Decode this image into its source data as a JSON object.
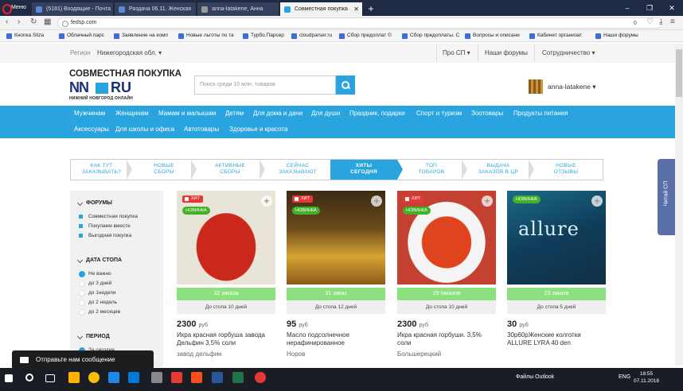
{
  "browser": {
    "menu_label": "Меню",
    "tabs": [
      {
        "label": "(5181) Входящие - Почта"
      },
      {
        "label": "Раздача 06.11. Женская"
      },
      {
        "label": "anna-latakene, Анна"
      },
      {
        "label": "Совместная покупка"
      }
    ],
    "url": "fedsp.com",
    "badge_count": "0",
    "bookmarks": [
      "Кнопка Sliza",
      "Облачный парс",
      "Заявление на комп",
      "Новые льготы по та",
      "Турбо.Парсер",
      "cloudparser.ru",
      "Сбор предоплат ©",
      "Сбор предоплаты. С",
      "Вопросы и описани",
      "Кабинет организат",
      "Наши форумы"
    ]
  },
  "topnav": {
    "region_label": "Регион",
    "region_value": "Нижегородская обл.",
    "about": "Про СП",
    "forums": "Наши форумы",
    "cooperation": "Сотрудничество"
  },
  "header": {
    "title": "СОВМЕСТНАЯ ПОКУПКА",
    "logo_left": "NN",
    "logo_right": "RU",
    "logo_sub": "НИЖНИЙ НОВГОРОД ОНЛАЙН",
    "search_placeholder": "Поиск среди 10 млн. товаров",
    "username": "anna-latakene"
  },
  "categories": {
    "row1": [
      "Мужчинам",
      "Женщинам",
      "Мамам и малышам",
      "Детям",
      "Для дома и дачи",
      "Для души",
      "Праздник, подарки",
      "Спорт и туризм",
      "Зоотовары",
      "Продукты питания"
    ],
    "row2": [
      "Аксессуары",
      "Для школы и офиса",
      "Автотовары",
      "Здоровье и красота"
    ]
  },
  "steps": [
    {
      "line1": "КАК ТУТ",
      "line2": "ЗАКАЗЫВАТЬ?"
    },
    {
      "line1": "НОВЫЕ",
      "line2": "СБОРЫ"
    },
    {
      "line1": "АКТИВНЫЕ",
      "line2": "СБОРЫ"
    },
    {
      "line1": "СЕЙЧАС",
      "line2": "ЗАКАЗЫВАЮТ"
    },
    {
      "line1": "ХИТЫ",
      "line2": "СЕГОДНЯ"
    },
    {
      "line1": "ТОП",
      "line2": "ТОВАРОВ"
    },
    {
      "line1": "ВЫДАЧА",
      "line2": "ЗАКАЗОВ В ЦР"
    },
    {
      "line1": "НОВЫЕ",
      "line2": "ОТЗЫВЫ"
    }
  ],
  "sidebar": {
    "forums_title": "ФОРУМЫ",
    "forums": [
      "Совместная покупка",
      "Покупаем вместе",
      "Выгодная покупка"
    ],
    "stop_title": "ДАТА СТОПА",
    "stop_options": [
      "Не важно",
      "до 3 дней",
      "до 1недели",
      "до 2 недель",
      "до 2 месяцев"
    ],
    "period_title": "ПЕРИОД",
    "period_first": "За сегодня"
  },
  "badges": {
    "hit": "ХИТ",
    "new": "НОВИНКА"
  },
  "products": [
    {
      "orders": "32 заказа",
      "stop": "До стопа 10 дней",
      "price": "2300",
      "currency": "руб",
      "title": "Икра красная горбуша завода Дельфин 3,5% соли",
      "seller": "завод дельфин"
    },
    {
      "orders": "31 заказ",
      "stop": "До стопа 12 дней",
      "price": "95",
      "currency": "руб",
      "title": "Масло подсолнечное нерафинированное",
      "seller": "Норов"
    },
    {
      "orders": "29 заказов",
      "stop": "До стопа 10 дней",
      "price": "2300",
      "currency": "руб",
      "title": "Икра красная горбуши. 3,5% соли",
      "seller": "Большерецкий"
    },
    {
      "orders": "23 заказа",
      "stop": "До стопа 5 дней",
      "price": "30",
      "currency": "руб",
      "title": "30р60рЖенские колготки ALLURE LYRA 40 den",
      "seller": ""
    }
  ],
  "product_photo_text": "allure",
  "side_tab": "Читай СП",
  "chat": "Отправьте нам сообщение",
  "taskbar": {
    "tray": "Файлы Outlook",
    "lang": "ENG",
    "time": "18:55",
    "date": "07.11.2018"
  }
}
